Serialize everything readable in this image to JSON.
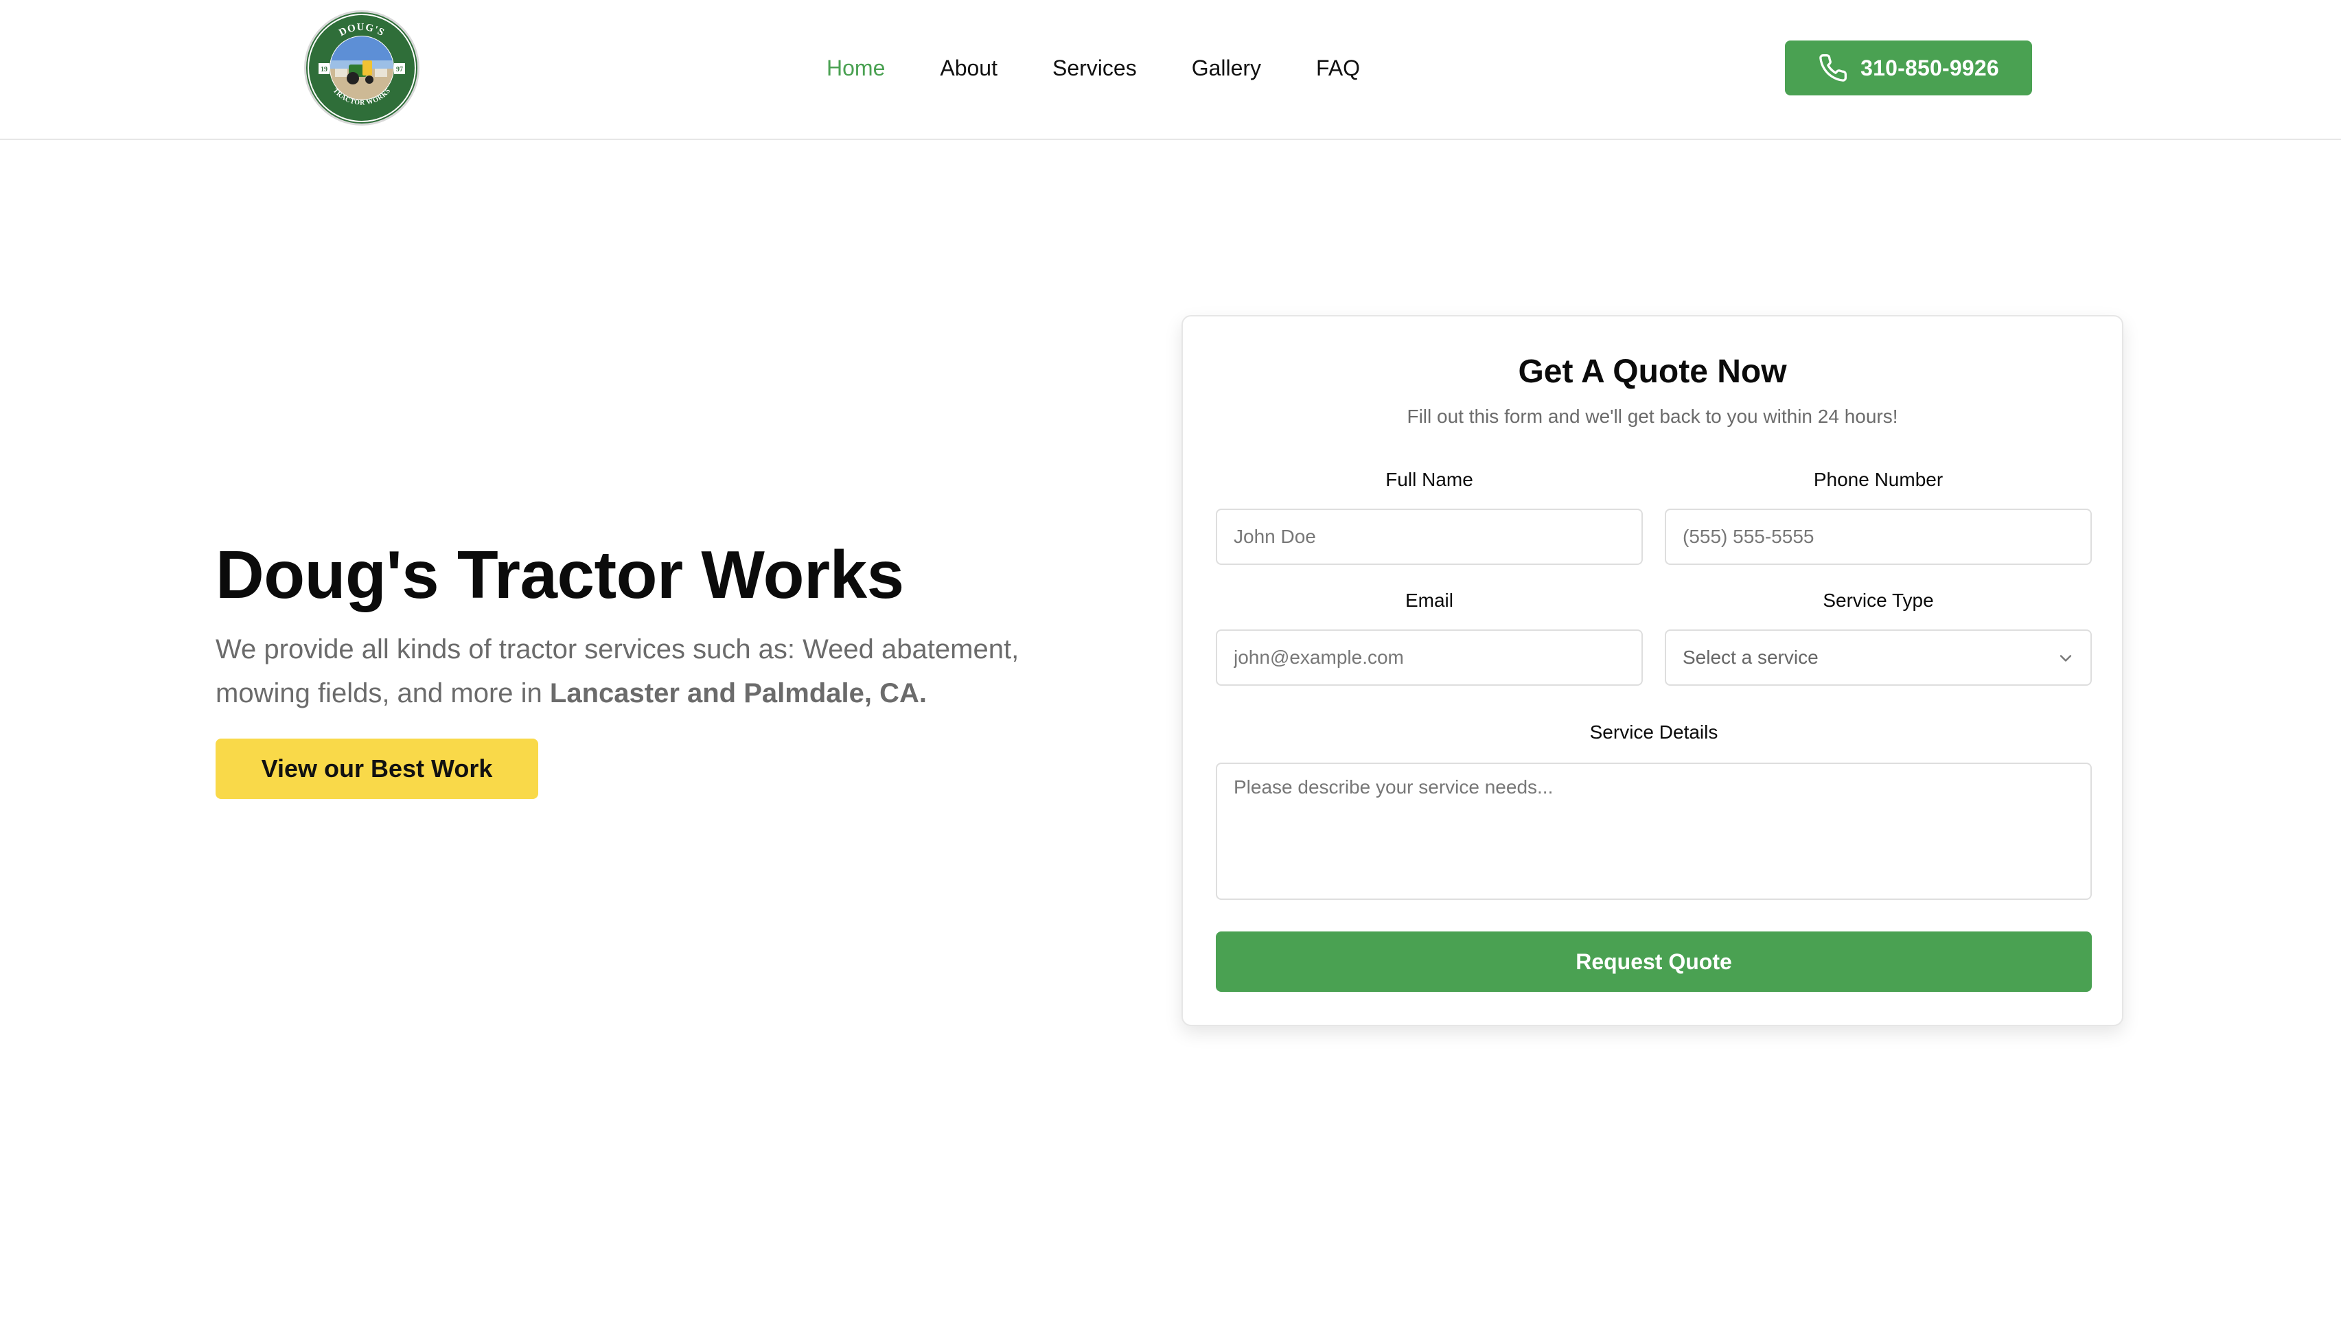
{
  "header": {
    "logo": {
      "text_top": "DOUG'S",
      "text_bottom": "TRACTOR WORKS",
      "year_left": "19",
      "year_right": "97"
    },
    "nav": [
      {
        "label": "Home",
        "active": true
      },
      {
        "label": "About",
        "active": false
      },
      {
        "label": "Services",
        "active": false
      },
      {
        "label": "Gallery",
        "active": false
      },
      {
        "label": "FAQ",
        "active": false
      }
    ],
    "phone": {
      "icon": "phone-icon",
      "label": "310-850-9926"
    }
  },
  "hero": {
    "title": "Doug's Tractor Works",
    "description_prefix": "We provide all kinds of tractor services such as: Weed abatement, mowing fields, and more in",
    "description_highlight": "Lancaster and Palmdale, CA.",
    "cta_label": "View our Best Work"
  },
  "quote_form": {
    "title": "Get A Quote Now",
    "subtitle": "Fill out this form and we'll get back to you within 24 hours!",
    "full_name": {
      "label": "Full Name",
      "placeholder": "John Doe"
    },
    "phone_number": {
      "label": "Phone Number",
      "placeholder": "(555) 555-5555"
    },
    "email": {
      "label": "Email",
      "placeholder": "john@example.com"
    },
    "service_type": {
      "label": "Service Type",
      "value": "Select a service",
      "icon": "chevron-down-icon"
    },
    "service_details": {
      "label": "Service Details",
      "placeholder": "Please describe your service needs..."
    },
    "submit_label": "Request Quote"
  },
  "colors": {
    "brand_green": "#4aa152",
    "accent_yellow": "#f9d949",
    "text_muted": "#6b6b6b",
    "border": "#dedede"
  }
}
